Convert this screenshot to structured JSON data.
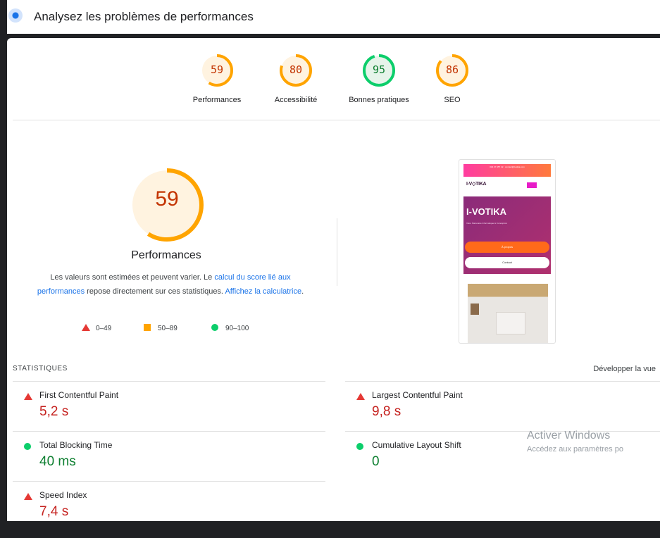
{
  "header": {
    "title": "Analysez les problèmes de performances"
  },
  "colors": {
    "poor": "#e53935",
    "average": "#ffa400",
    "good": "#0cce6b"
  },
  "gauges": [
    {
      "label": "Performances",
      "score": "59",
      "value": 59,
      "status": "average"
    },
    {
      "label": "Accessibilité",
      "score": "80",
      "value": 80,
      "status": "average"
    },
    {
      "label": "Bonnes pratiques",
      "score": "95",
      "value": 95,
      "status": "good"
    },
    {
      "label": "SEO",
      "score": "86",
      "value": 86,
      "status": "average"
    }
  ],
  "main_score": {
    "score": "59",
    "value": 59,
    "title": "Performances",
    "desc_part1": "Les valeurs sont estimées et peuvent varier. Le ",
    "link1": "calcul du score lié aux performances",
    "desc_part2": " repose directement sur ces statistiques. ",
    "link2": "Affichez la calculatrice",
    "desc_end": "."
  },
  "legend": [
    {
      "icon": "triangle-icon",
      "label": "0–49"
    },
    {
      "icon": "square-icon",
      "label": "50–89"
    },
    {
      "icon": "circle-icon",
      "label": "90–100"
    }
  ],
  "screenshot_preview": {
    "top_strip": "034 37 457 42 · contact@ivotika.com",
    "logo": "I-V◇TIKA",
    "hero_title": "I-VOTIKA",
    "hero_sub": "Votre Partenaire Informatique & Conception",
    "primary_button": "À propos",
    "secondary_button": "Contact"
  },
  "stats": {
    "heading": "STATISTIQUES",
    "expand_label": "Développer la vue",
    "metrics": [
      {
        "name": "First Contentful Paint",
        "value": "5,2 s",
        "status": "bad"
      },
      {
        "name": "Largest Contentful Paint",
        "value": "9,8 s",
        "status": "bad"
      },
      {
        "name": "Total Blocking Time",
        "value": "40 ms",
        "status": "good"
      },
      {
        "name": "Cumulative Layout Shift",
        "value": "0",
        "status": "good"
      },
      {
        "name": "Speed Index",
        "value": "7,4 s",
        "status": "bad"
      }
    ]
  },
  "watermark": {
    "line1": "Activer Windows",
    "line2": "Accédez aux paramètres po"
  }
}
